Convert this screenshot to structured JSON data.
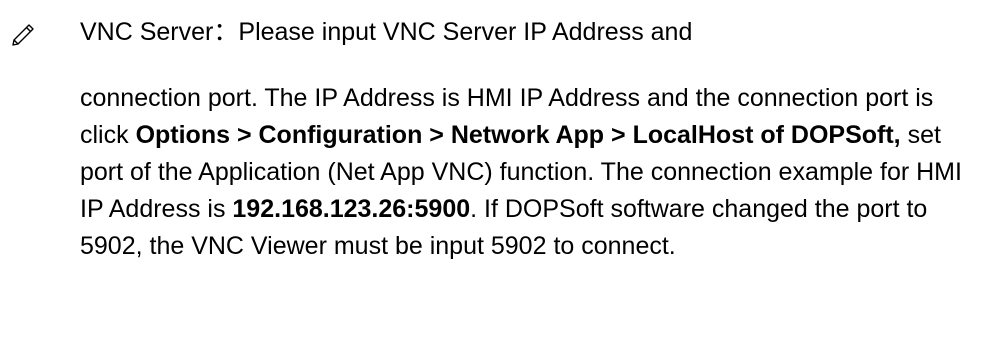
{
  "bullet": {
    "icon": "pencil-icon"
  },
  "heading": {
    "label": "VNC Server",
    "separator": "：",
    "rest": "Please input VNC Server IP Address and"
  },
  "paragraph": {
    "t1": "connection port. The IP Address is HMI IP Address and the connection port is click ",
    "b1": "Options > Configuration > Network App > LocalHost of DOPSoft,",
    "t2": " set port of the Application (Net App VNC) function. The connection example for HMI IP Address is ",
    "b2": "192.168.123.26:5900",
    "t3": ". If DOPSoft software changed the port to 5902, the VNC Viewer must be input 5902 to connect."
  }
}
